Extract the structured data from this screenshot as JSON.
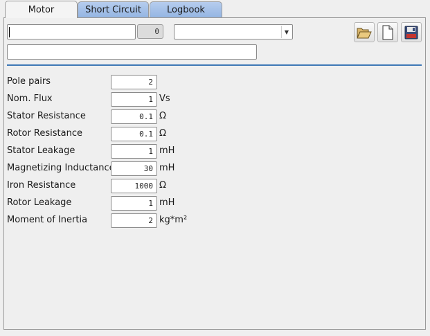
{
  "tabs": [
    "Motor",
    "Short Circuit",
    "Logbook"
  ],
  "header": {
    "name_value": "",
    "id_value": "0",
    "selector_value": "",
    "description_value": ""
  },
  "toolbar": {
    "open": "folder-open-icon",
    "new": "new-file-icon",
    "save": "save-icon"
  },
  "params": [
    {
      "label": "Pole pairs",
      "value": "2",
      "unit": ""
    },
    {
      "label": "Nom. Flux",
      "value": "1",
      "unit": "Vs"
    },
    {
      "label": "Stator Resistance",
      "value": "0.1",
      "unit": "Ω"
    },
    {
      "label": "Rotor Resistance",
      "value": "0.1",
      "unit": "Ω"
    },
    {
      "label": "Stator Leakage",
      "value": "1",
      "unit": "mH"
    },
    {
      "label": "Magnetizing Inductance",
      "value": "30",
      "unit": "mH"
    },
    {
      "label": "Iron Resistance",
      "value": "1000",
      "unit": "Ω"
    },
    {
      "label": "Rotor Leakage",
      "value": "1",
      "unit": "mH"
    },
    {
      "label": "Moment of Inertia",
      "value": "2",
      "unit": "kg*m²"
    }
  ],
  "colors": {
    "tab_inactive": "#a9c4ec",
    "separator": "#3d78b5"
  }
}
